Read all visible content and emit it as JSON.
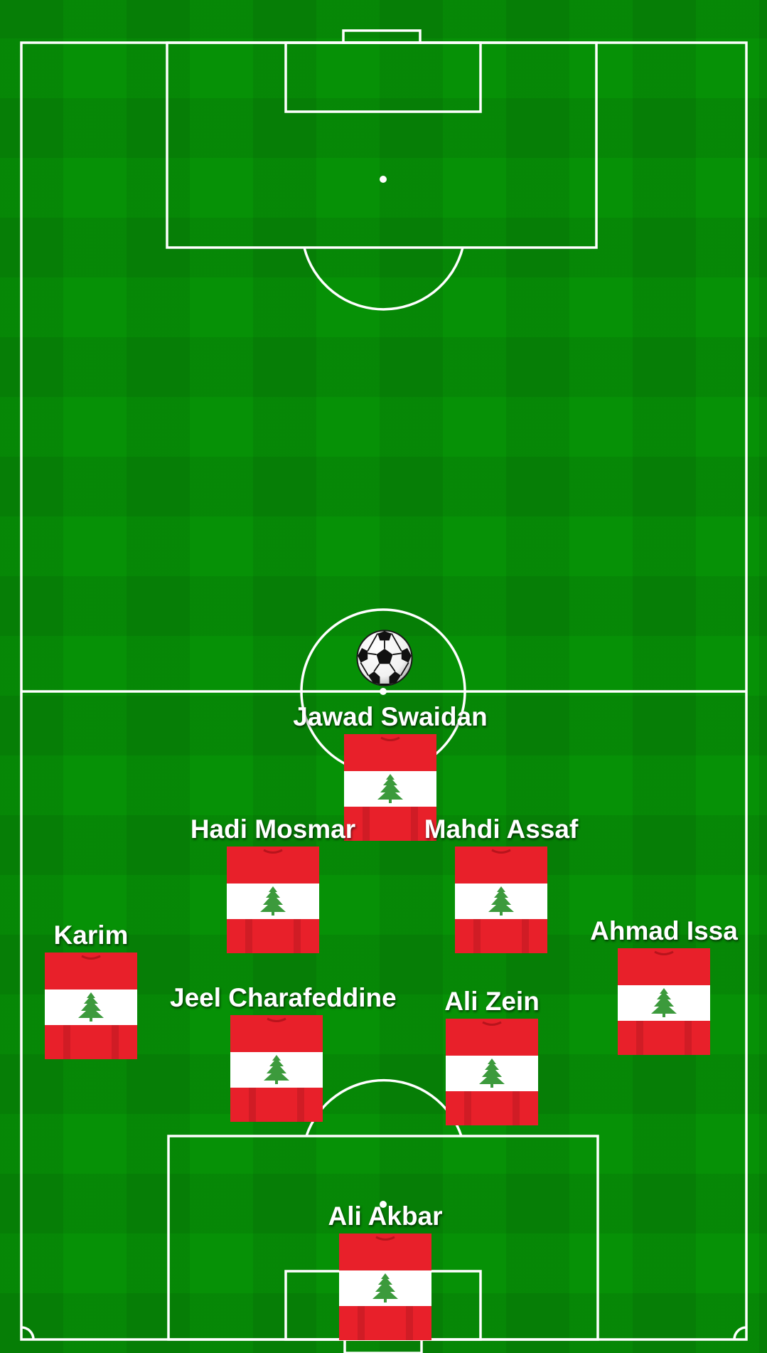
{
  "pitch": {
    "colors": {
      "grass": "#069106",
      "lines": "#ffffff",
      "jersey_red": "#e8202a",
      "jersey_white": "#ffffff",
      "cedar_green": "#3c9a3c"
    }
  },
  "ball": {
    "icon": "soccer-ball-icon"
  },
  "players": [
    {
      "name": "Jawad Swaidan"
    },
    {
      "name": "Hadi Mosmar"
    },
    {
      "name": "Mahdi Assaf"
    },
    {
      "name": "Karim"
    },
    {
      "name": "Ahmad Issa"
    },
    {
      "name": "Jeel Charafeddine"
    },
    {
      "name": "Ali Zein"
    },
    {
      "name": "Ali Akbar"
    }
  ],
  "jersey": {
    "icon": "lebanon-jersey-icon"
  }
}
